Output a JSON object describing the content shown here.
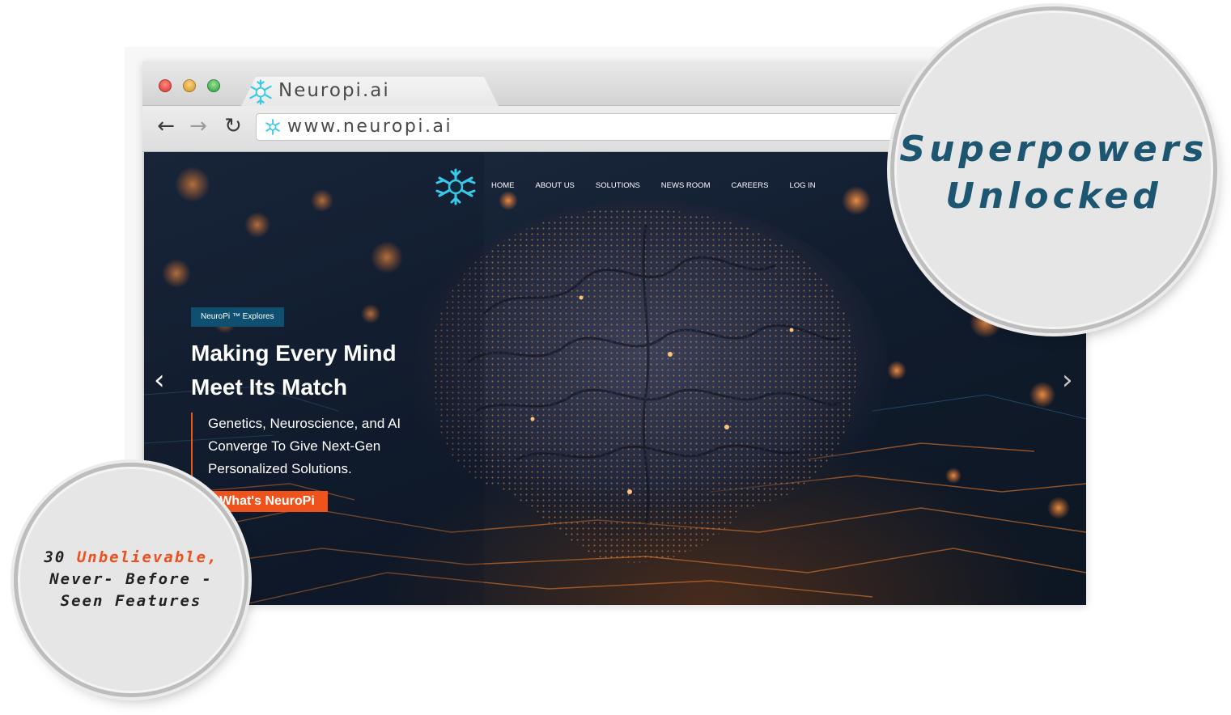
{
  "browser": {
    "tab_title": "Neuropi.ai",
    "url": "www.neuropi.ai"
  },
  "site": {
    "nav": [
      "HOME",
      "ABOUT US",
      "SOLUTIONS",
      "NEWS ROOM",
      "CAREERS",
      "LOG IN"
    ],
    "badge": "NeuroPi ™ Explores",
    "headline_line1": "Making Every Mind",
    "headline_line2": "Meet Its Match",
    "sub_line1": "Genetics, Neuroscience, and AI",
    "sub_line2": "Converge To Give Next-Gen",
    "sub_line3": "Personalized Solutions.",
    "cta": "What's NeuroPi",
    "prev_arrow": "‹",
    "next_arrow": "›"
  },
  "callouts": {
    "big_line1": "Superpowers",
    "big_line2": "Unlocked",
    "small_num": "30",
    "small_highlight": "Unbelievable,",
    "small_line2": "Never- Before -",
    "small_line3": "Seen Features"
  },
  "colors": {
    "accent_orange": "#f0521c",
    "badge_teal": "#0f5070",
    "logo_cyan": "#37c9e8",
    "callout_blue": "#1d5670"
  },
  "icons": {
    "back": "arrow-left-icon",
    "forward": "arrow-right-icon",
    "reload": "reload-icon",
    "brand": "neuron-logo-icon"
  }
}
